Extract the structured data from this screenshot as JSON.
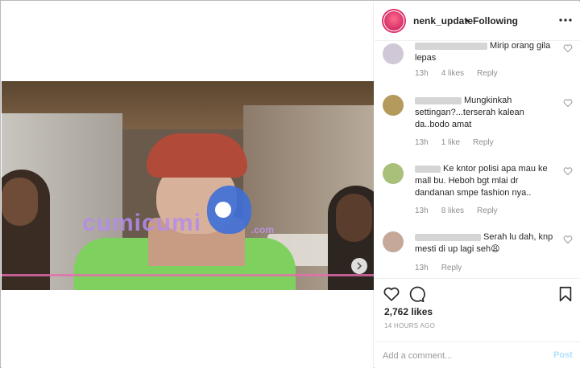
{
  "header": {
    "username": "nenk_update",
    "separator": "•",
    "following_label": "Following",
    "more_icon": "more-horizontal-icon"
  },
  "media": {
    "watermark": "cumicumi",
    "watermark_domain": ".com",
    "next_icon": "chevron-right-icon"
  },
  "comments": [
    {
      "user_redacted": true,
      "text": "Mirip orang gila lepas",
      "time": "13h",
      "likes": "4 likes",
      "reply": "Reply"
    },
    {
      "user_redacted": true,
      "text": "Mungkinkah settingan?...terserah kalean da..bodo amat",
      "time": "13h",
      "likes": "1 like",
      "reply": "Reply"
    },
    {
      "user_redacted": true,
      "text": "Ke kntor polisi apa mau ke mall bu. Heboh bgt mlai dr dandanan smpe fashion nya..",
      "time": "13h",
      "likes": "8 likes",
      "reply": "Reply"
    },
    {
      "user_redacted": true,
      "text": "Serah lu dah, knp mesti di up lagi seh😩",
      "time": "13h",
      "likes": "",
      "reply": "Reply"
    }
  ],
  "actions": {
    "like_icon": "heart-icon",
    "comment_icon": "comment-icon",
    "save_icon": "bookmark-icon"
  },
  "stats": {
    "likes": "2,762 likes",
    "time_ago": "14 HOURS AGO"
  },
  "add_comment": {
    "placeholder": "Add a comment...",
    "post_label": "Post"
  },
  "colors": {
    "ring": "#e1306c",
    "post_disabled": "#b2dffc",
    "meta_text": "#999999"
  }
}
